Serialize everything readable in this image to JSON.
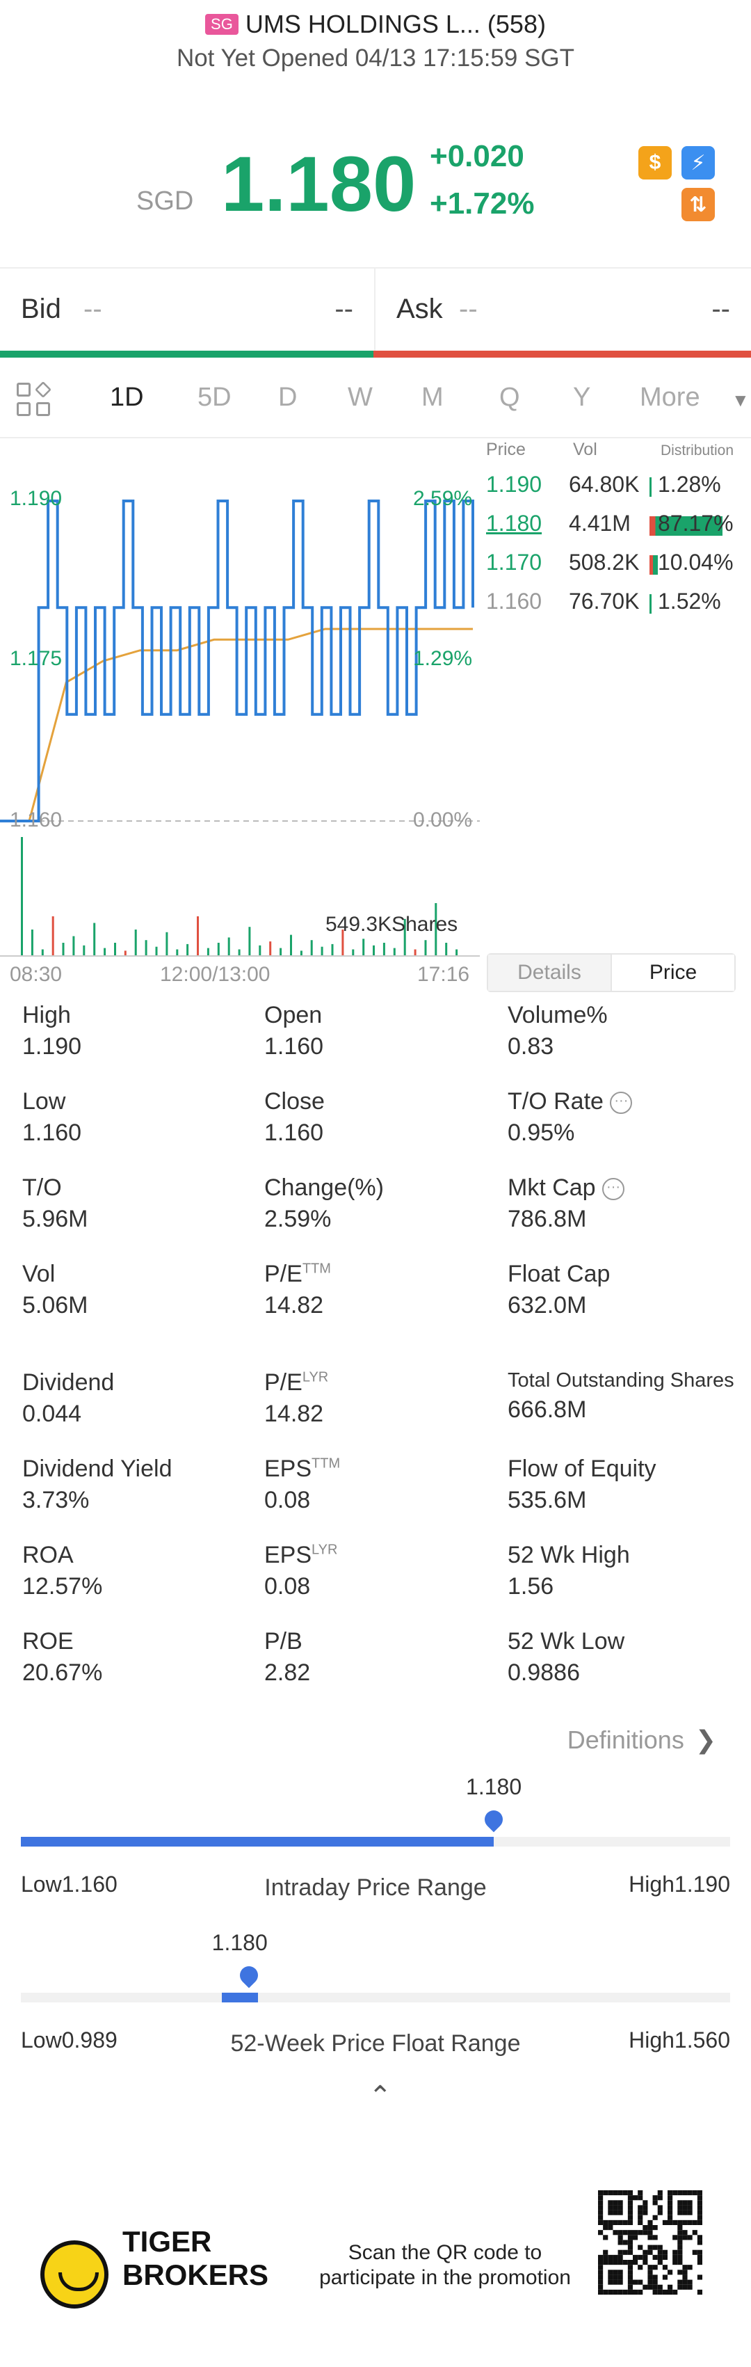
{
  "header": {
    "market_badge": "SG",
    "title": "UMS HOLDINGS L... (558)",
    "subtitle": "Not Yet Opened 04/13 17:15:59 SGT"
  },
  "quote": {
    "currency": "SGD",
    "price": "1.180",
    "change": "+0.020",
    "change_pct": "+1.72%",
    "icons": [
      "dollar-icon",
      "lightning-icon",
      "trade-icon"
    ]
  },
  "bidask": {
    "bid_label": "Bid",
    "bid_price": "--",
    "bid_size": "--",
    "ask_label": "Ask",
    "ask_price": "--",
    "ask_size": "--"
  },
  "tabs": [
    "1D",
    "5D",
    "D",
    "W",
    "M",
    "Q",
    "Y",
    "More"
  ],
  "active_tab": "1D",
  "chart_labels": {
    "y_top_left": "1.190",
    "y_mid_left": "1.175",
    "y_bottom_left": "1.160",
    "y_top_right": "2.59%",
    "y_mid_right": "1.29%",
    "y_bottom_right": "0.00%",
    "volume_label": "549.3KShares",
    "x_start": "08:30",
    "x_mid": "12:00/13:00",
    "x_end": "17:16"
  },
  "chart_data": {
    "type": "line",
    "title": "",
    "xlabel": "",
    "ylabel": "",
    "ylim": [
      1.16,
      1.19
    ],
    "x": [
      "08:30",
      "12:00/13:00",
      "17:16"
    ],
    "series": [
      {
        "name": "",
        "values": [
          1.16,
          1.18,
          1.19,
          1.18,
          1.17,
          1.18,
          1.18,
          1.19,
          1.18,
          1.17,
          1.18,
          1.19,
          1.18
        ]
      },
      {
        "name": "",
        "values": [
          1.16,
          1.173,
          1.175,
          1.176,
          1.176,
          1.177,
          1.177,
          1.177,
          1.178,
          1.178,
          1.178,
          1.178,
          1.178
        ]
      }
    ],
    "grid": false
  },
  "distribution": {
    "headers": {
      "price": "Price",
      "vol": "Vol",
      "dist": "Distribution"
    },
    "rows": [
      {
        "price": "1.190",
        "vol": "64.80K",
        "pct": "1.28%",
        "fraction": 0.0128
      },
      {
        "price": "1.180",
        "vol": "4.41M",
        "pct": "87.17%",
        "fraction": 0.8717
      },
      {
        "price": "1.170",
        "vol": "508.2K",
        "pct": "10.04%",
        "fraction": 0.1004
      },
      {
        "price": "1.160",
        "vol": "76.70K",
        "pct": "1.52%",
        "fraction": 0.0152
      }
    ]
  },
  "segment": {
    "details": "Details",
    "price": "Price"
  },
  "stats": {
    "high": {
      "label": "High",
      "value": "1.190"
    },
    "open": {
      "label": "Open",
      "value": "1.160"
    },
    "volume_pct": {
      "label": "Volume%",
      "value": "0.83"
    },
    "low": {
      "label": "Low",
      "value": "1.160"
    },
    "close": {
      "label": "Close",
      "value": "1.160"
    },
    "to_rate": {
      "label": "T/O Rate",
      "value": "0.95%"
    },
    "to": {
      "label": "T/O",
      "value": "5.96M"
    },
    "change": {
      "label": "Change(%)",
      "value": "2.59%"
    },
    "mkt_cap": {
      "label": "Mkt Cap",
      "value": "786.8M"
    },
    "vol": {
      "label": "Vol",
      "value": "5.06M"
    },
    "pe_ttm": {
      "label": "P/E",
      "sup": "TTM",
      "value": "14.82"
    },
    "float_cap": {
      "label": "Float Cap",
      "value": "632.0M"
    },
    "dividend": {
      "label": "Dividend",
      "value": "0.044"
    },
    "pe_lyr": {
      "label": "P/E",
      "sup": "LYR",
      "value": "14.82"
    },
    "total_shares": {
      "label": "Total Outstanding Shares",
      "value": "666.8M"
    },
    "dividend_yield": {
      "label": "Dividend Yield",
      "value": "3.73%"
    },
    "eps_ttm": {
      "label": "EPS",
      "sup": "TTM",
      "value": "0.08"
    },
    "flow_equity": {
      "label": "Flow of Equity",
      "value": "535.6M"
    },
    "roa": {
      "label": "ROA",
      "value": "12.57%"
    },
    "eps_lyr": {
      "label": "EPS",
      "sup": "LYR",
      "value": "0.08"
    },
    "wk52_high": {
      "label": "52 Wk High",
      "value": "1.56"
    },
    "roe": {
      "label": "ROE",
      "value": "20.67%"
    },
    "pb": {
      "label": "P/B",
      "value": "2.82"
    },
    "wk52_low": {
      "label": "52 Wk Low",
      "value": "0.9886"
    }
  },
  "definitions_label": "Definitions",
  "intraday_range": {
    "title": "Intraday Price Range",
    "low": "Low1.160",
    "high": "High1.190",
    "current": "1.180",
    "fraction": 0.6667
  },
  "week52_range": {
    "title": "52-Week Price Float Range",
    "low": "Low0.989",
    "high": "High1.560",
    "current": "1.180",
    "fraction": 0.334
  },
  "promo": {
    "brand_line1": "TIGER",
    "brand_line2": "BROKERS",
    "text": "Scan the QR code to participate in the promotion"
  },
  "colors": {
    "up_green": "#1aa36a",
    "down_red": "#e05040",
    "accent_blue": "#3e74e0",
    "line_blue": "#2f7fd6",
    "avg_orange": "#e4a23c"
  }
}
